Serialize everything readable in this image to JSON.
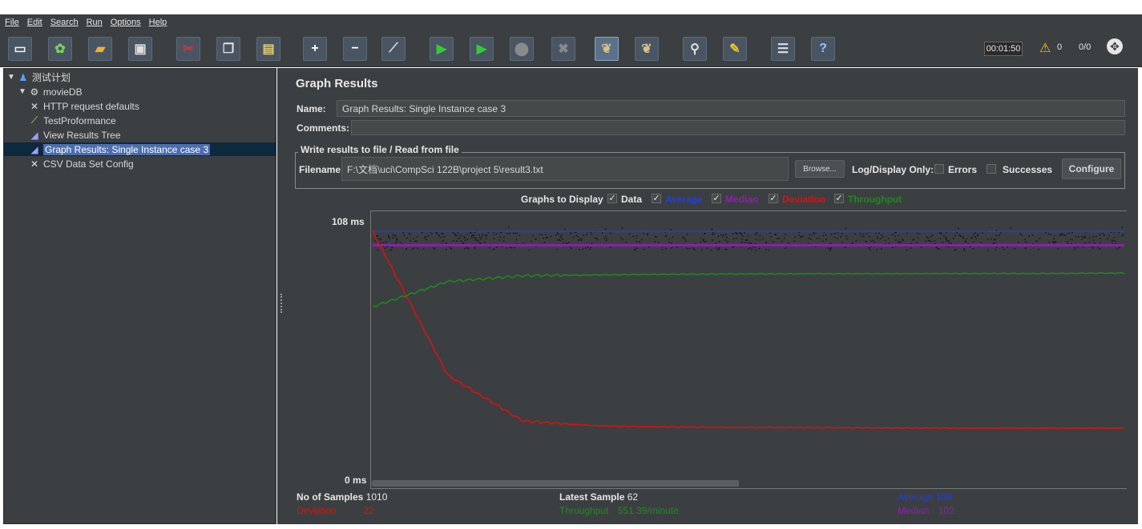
{
  "menu": [
    "File",
    "Edit",
    "Search",
    "Run",
    "Options",
    "Help"
  ],
  "toolbar": {
    "buttons": [
      {
        "name": "new-icon",
        "glyph": "▭",
        "color": "#f0f0f0"
      },
      {
        "name": "templates-icon",
        "glyph": "✿",
        "color": "#7ccf5a"
      },
      {
        "name": "open-icon",
        "glyph": "▰",
        "color": "#f0b030"
      },
      {
        "name": "save-icon",
        "glyph": "▣",
        "color": "#e0e0e0"
      },
      {
        "name": "cut-icon",
        "glyph": "✂",
        "color": "#e03030"
      },
      {
        "name": "copy-icon",
        "glyph": "❐",
        "color": "#e0e0e0"
      },
      {
        "name": "paste-icon",
        "glyph": "▤",
        "color": "#e0d070"
      },
      {
        "name": "expand-icon",
        "glyph": "+",
        "color": "#ffffff"
      },
      {
        "name": "collapse-icon",
        "glyph": "−",
        "color": "#ffffff"
      },
      {
        "name": "toggle-icon",
        "glyph": "⟋",
        "color": "#e0e0e0"
      },
      {
        "name": "start-icon",
        "glyph": "▶",
        "color": "#33cc33"
      },
      {
        "name": "start-no-pauses-icon",
        "glyph": "▶",
        "color": "#33cc33"
      },
      {
        "name": "stop-icon",
        "glyph": "⬤",
        "color": "#8a8a8a"
      },
      {
        "name": "shutdown-icon",
        "glyph": "✖",
        "color": "#8a8a8a"
      },
      {
        "name": "clear-icon",
        "glyph": "❦",
        "color": "#d8c08a"
      },
      {
        "name": "clear-all-icon",
        "glyph": "❦",
        "color": "#d8c08a"
      },
      {
        "name": "search-icon",
        "glyph": "⚲",
        "color": "#e0e0e0"
      },
      {
        "name": "reset-search-icon",
        "glyph": "✎",
        "color": "#f0c030"
      },
      {
        "name": "function-helper-icon",
        "glyph": "☰",
        "color": "#e0e0e0"
      },
      {
        "name": "help-icon",
        "glyph": "?",
        "color": "#a0c0ff"
      }
    ],
    "timer": "00:01:50",
    "warnings": "0",
    "threads": "0/0"
  },
  "tree": {
    "items": [
      {
        "label": "测试计划",
        "name": "tree-item-test-plan",
        "icon": "test-plan-icon",
        "glyph": "♟",
        "color": "#5aa0ff",
        "level": 0,
        "toggle": "▼"
      },
      {
        "label": "movieDB",
        "name": "tree-item-moviedb",
        "icon": "thread-group-icon",
        "glyph": "⚙",
        "color": "#e0e0e0",
        "level": 1,
        "toggle": "▼"
      },
      {
        "label": "HTTP request defaults",
        "name": "tree-item-http-request-defaults",
        "icon": "config-icon",
        "glyph": "✕",
        "color": "#e0e0e0",
        "level": 2
      },
      {
        "label": "TestProformance",
        "name": "tree-item-testproformance",
        "icon": "sampler-icon",
        "glyph": "⟋",
        "color": "#c0e060",
        "level": 2
      },
      {
        "label": "View Results Tree",
        "name": "tree-item-view-results-tree",
        "icon": "listener-icon",
        "glyph": "◢",
        "color": "#a0a0ff",
        "level": 2
      },
      {
        "label": "Graph Results: Single Instance case 3",
        "name": "tree-item-graph-results",
        "icon": "listener-icon",
        "glyph": "◢",
        "color": "#a0a0ff",
        "level": 2,
        "selected": true
      },
      {
        "label": "CSV Data Set Config",
        "name": "tree-item-csv-data-set-config",
        "icon": "config-icon",
        "glyph": "✕",
        "color": "#e0e0e0",
        "level": 2
      }
    ]
  },
  "panel": {
    "title": "Graph Results",
    "name_label": "Name:",
    "name_value": "Graph Results: Single Instance case 3",
    "comments_label": "Comments:",
    "comments_value": "",
    "file_legend": "Write results to file / Read from file",
    "filename_label": "Filename",
    "filename_value": "F:\\文档\\uci\\CompSci 122B\\project 5\\result3.txt",
    "browse_label": "Browse...",
    "log_only_label": "Log/Display Only:",
    "errors_label": "Errors",
    "successes_label": "Successes",
    "configure_label": "Configure"
  },
  "graphs_to_display": {
    "label": "Graphs to Display",
    "options": [
      {
        "label": "Data",
        "color": "#e6e6e6",
        "checked": true
      },
      {
        "label": "Average",
        "color": "#1f3df0",
        "checked": true
      },
      {
        "label": "Median",
        "color": "#8e1fb0",
        "checked": true
      },
      {
        "label": "Deviation",
        "color": "#e01010",
        "checked": true
      },
      {
        "label": "Throughput",
        "color": "#1f8a1f",
        "checked": true
      }
    ]
  },
  "axis": {
    "top_label": "108",
    "bottom_label": "0",
    "unit": "ms"
  },
  "stats": {
    "samples_label": "No of Samples",
    "samples_value": "1010",
    "latest_label": "Latest Sample",
    "latest_value": "62",
    "average_label": "Average",
    "average_value": "108",
    "deviation_label": "Deviation",
    "deviation_value": "22",
    "throughput_label": "Throughput",
    "throughput_value": "551.39/minute",
    "median_label": "Median",
    "median_value": "102",
    "colors": {
      "black": "#e6e6e6",
      "blue": "#1f3df0",
      "red": "#e01010",
      "green": "#1f8a1f",
      "purple": "#8e1fb0"
    }
  },
  "chart_data": {
    "type": "line",
    "ylim": [
      0,
      108
    ],
    "series": [
      {
        "name": "Average",
        "color": "#1f3df0",
        "values": [
          108,
          108,
          108,
          108,
          108,
          108,
          108,
          108,
          108,
          108,
          108
        ]
      },
      {
        "name": "Median",
        "color": "#8e1fb0",
        "values": [
          102,
          102,
          102,
          102,
          102,
          102,
          102,
          102,
          102,
          102,
          102
        ]
      },
      {
        "name": "Deviation",
        "color": "#e01010",
        "values": [
          108,
          45,
          25,
          23,
          22.5,
          22.3,
          22.2,
          22.1,
          22,
          22,
          22
        ]
      },
      {
        "name": "Throughput",
        "color": "#1f8a1f",
        "values": [
          75,
          86,
          88.5,
          89,
          89.3,
          89.4,
          89.5,
          89.5,
          89.6,
          89.6,
          89.8
        ]
      }
    ]
  }
}
